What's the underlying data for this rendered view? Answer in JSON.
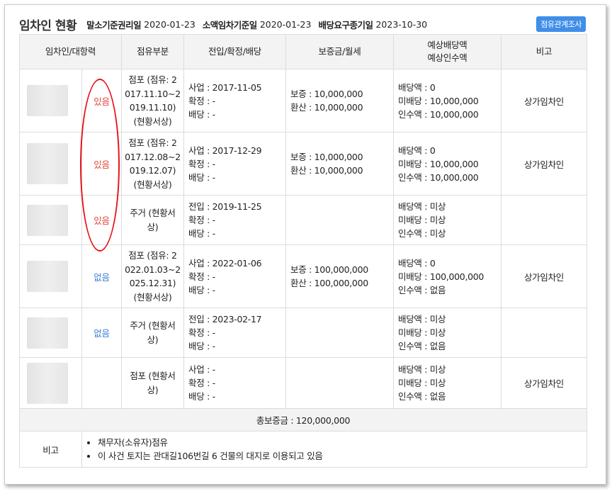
{
  "header": {
    "title": "임차인 현황",
    "items": [
      {
        "label": "말소기준권리일",
        "value": "2020-01-23"
      },
      {
        "label": "소액임차기준일",
        "value": "2020-01-23"
      },
      {
        "label": "배당요구종기일",
        "value": "2023-10-30"
      }
    ],
    "button_label": "점유관계조사"
  },
  "table": {
    "headers": {
      "tenant": "임차인/대항력",
      "occupancy": "점유부분",
      "dates": "전입/확정/배당",
      "deposit": "보증금/월세",
      "expected_line1": "예상배당액",
      "expected_line2": "예상인수액",
      "remarks": "비고"
    },
    "rows": [
      {
        "opposition": "있음",
        "occupancy": [
          "점포 (점유: 2",
          "017.11.10~2",
          "019.11.10)",
          "(현황서상)"
        ],
        "dates": [
          "사업 : 2017-11-05",
          "확정 : -",
          "배당 : -"
        ],
        "deposit": [
          "보증 : 10,000,000",
          "환산 : 10,000,000"
        ],
        "expected": [
          "배당액 : 0",
          "미배당 : 10,000,000",
          "인수액 : 10,000,000"
        ],
        "remark": "상가임차인"
      },
      {
        "opposition": "있음",
        "occupancy": [
          "점포 (점유: 2",
          "017.12.08~2",
          "019.12.07)",
          "(현황서상)"
        ],
        "dates": [
          "사업 : 2017-12-29",
          "확정 : -",
          "배당 : -"
        ],
        "deposit": [
          "보증 : 10,000,000",
          "환산 : 10,000,000"
        ],
        "expected": [
          "배당액 : 0",
          "미배당 : 10,000,000",
          "인수액 : 10,000,000"
        ],
        "remark": "상가임차인"
      },
      {
        "opposition": "있음",
        "occupancy": [
          "주거 (현황서",
          "상)"
        ],
        "dates": [
          "전입 : 2019-11-25",
          "확정 : -",
          "배당 : -"
        ],
        "deposit": [],
        "expected": [
          "배당액 : 미상",
          "미배당 : 미상",
          "인수액 : 미상"
        ],
        "remark": ""
      },
      {
        "opposition": "없음",
        "occupancy": [
          "점포 (점유: 2",
          "022.01.03~2",
          "025.12.31)",
          "(현황서상)"
        ],
        "dates": [
          "사업 : 2022-01-06",
          "확정 : -",
          "배당 : -"
        ],
        "deposit": [
          "보증 : 100,000,000",
          "환산 : 100,000,000"
        ],
        "expected": [
          "배당액 : 0",
          "미배당 : 100,000,000",
          "인수액 : 없음"
        ],
        "remark": "상가임차인"
      },
      {
        "opposition": "없음",
        "occupancy": [
          "주거 (현황서",
          "상)"
        ],
        "dates": [
          "전입 : 2023-02-17",
          "확정 : -",
          "배당 : -"
        ],
        "deposit": [],
        "expected": [
          "배당액 : 미상",
          "미배당 : 미상",
          "인수액 : 없음"
        ],
        "remark": ""
      },
      {
        "opposition": "",
        "occupancy": [
          "점포 (현황서",
          "상)"
        ],
        "dates": [
          "사업 : -",
          "확정 : -",
          "배당 : -"
        ],
        "deposit": [],
        "expected": [
          "배당액 : 미상",
          "미배당 : 미상",
          "인수액 : 없음"
        ],
        "remark": "상가임차인"
      }
    ],
    "total": "총보증금 : 120,000,000",
    "notes_label": "비고",
    "notes": [
      "채무자(소유자)점유",
      "이 사건 토지는 관대길106번길 6 건물의 대지로 이용되고 있음"
    ]
  },
  "colors": {
    "button": "#3f8ee8",
    "opposition_yes": "#e0463c",
    "opposition_no": "#3b7fd4",
    "annotation_oval": "#e8141b"
  }
}
